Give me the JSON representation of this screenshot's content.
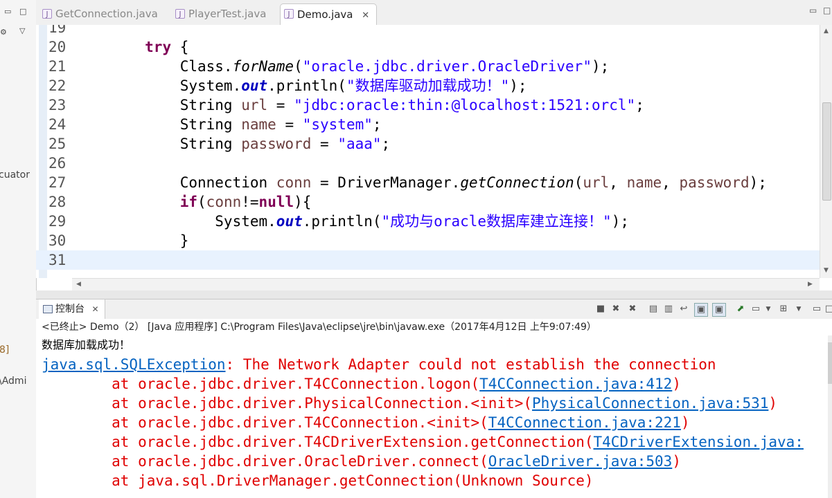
{
  "left_panel": {
    "clipped_text_1": "cuator",
    "clipped_text_2": "8]",
    "clipped_text_3": "\\Admi"
  },
  "tabs": [
    {
      "label": "GetConnection.java",
      "icon": "java-file-icon",
      "active": false
    },
    {
      "label": "PlayerTest.java",
      "icon": "java-file-icon",
      "active": false
    },
    {
      "label": "Demo.java",
      "icon": "java-file-icon",
      "active": true,
      "close": "✕"
    }
  ],
  "editor": {
    "lines": [
      {
        "num": "19",
        "code": ""
      },
      {
        "num": "20",
        "code": "        try {"
      },
      {
        "num": "21",
        "code": "            Class.forName(\"oracle.jdbc.driver.OracleDriver\");"
      },
      {
        "num": "22",
        "code": "            System.out.println(\"数据库驱动加载成功！\");"
      },
      {
        "num": "23",
        "code": "            String url = \"jdbc:oracle:thin:@localhost:1521:orcl\";"
      },
      {
        "num": "24",
        "code": "            String name = \"system\";"
      },
      {
        "num": "25",
        "code": "            String password = \"aaa\";"
      },
      {
        "num": "26",
        "code": ""
      },
      {
        "num": "27",
        "code": "            Connection conn = DriverManager.getConnection(url, name, password);"
      },
      {
        "num": "28",
        "code": "            if(conn!=null){"
      },
      {
        "num": "29",
        "code": "                System.out.println(\"成功与oracle数据库建立连接！\");"
      },
      {
        "num": "30",
        "code": "            }"
      },
      {
        "num": "31",
        "code": ""
      }
    ],
    "current_line": "31"
  },
  "console": {
    "tab_label": "控制台",
    "tab_close": "✕",
    "status": "<已终止> Demo（2） [Java 应用程序] C:\\Program Files\\Java\\eclipse\\jre\\bin\\javaw.exe（2017年4月12日 上午9:07:49）",
    "output_first": "数据库加载成功！",
    "exception_link": "java.sql.SQLException",
    "exception_message": ": The Network Adapter could not establish the connection",
    "stack": [
      {
        "prefix": "\tat oracle.jdbc.driver.T4CConnection.logon(",
        "link": "T4CConnection.java:412",
        "suffix": ")"
      },
      {
        "prefix": "\tat oracle.jdbc.driver.PhysicalConnection.<init>(",
        "link": "PhysicalConnection.java:531",
        "suffix": ")"
      },
      {
        "prefix": "\tat oracle.jdbc.driver.T4CConnection.<init>(",
        "link": "T4CConnection.java:221",
        "suffix": ")"
      },
      {
        "prefix": "\tat oracle.jdbc.driver.T4CDriverExtension.getConnection(",
        "link": "T4CDriverExtension.java:",
        "suffix": ""
      },
      {
        "prefix": "\tat oracle.jdbc.driver.OracleDriver.connect(",
        "link": "OracleDriver.java:503",
        "suffix": ")"
      },
      {
        "prefix": "\tat java.sql.DriverManager.getConnection(Unknown Source)",
        "link": "",
        "suffix": ""
      }
    ]
  }
}
